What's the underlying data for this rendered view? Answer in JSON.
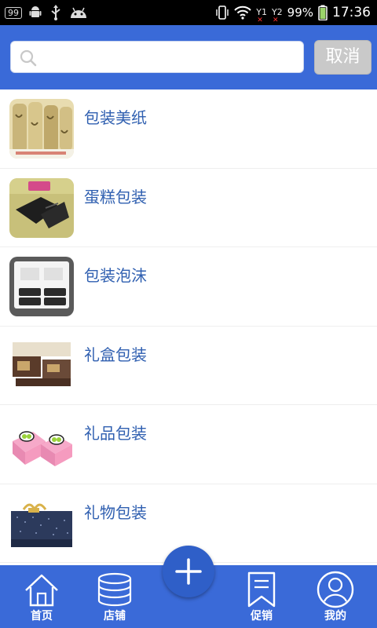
{
  "status_bar": {
    "badge": "99",
    "battery": "99%",
    "time": "17:36",
    "sim1": "Y1",
    "sim2": "Y2",
    "icons": [
      "android-icon",
      "usb-icon",
      "android-debug-icon",
      "vibrate-icon",
      "wifi-icon",
      "signal-icon",
      "battery-icon"
    ]
  },
  "search": {
    "placeholder": "",
    "value": "",
    "cancel_label": "取消"
  },
  "categories": [
    {
      "label": "包装美纸",
      "thumb": "wrapping-paper"
    },
    {
      "label": "蛋糕包装",
      "thumb": "cake-box"
    },
    {
      "label": "包装泡沫",
      "thumb": "foam-packaging"
    },
    {
      "label": "礼盒包装",
      "thumb": "gift-box"
    },
    {
      "label": "礼品包装",
      "thumb": "gift-wrap"
    },
    {
      "label": "礼物包装",
      "thumb": "present-box"
    }
  ],
  "bottom_nav": {
    "items": [
      {
        "label": "首页",
        "icon": "home-icon"
      },
      {
        "label": "店铺",
        "icon": "store-icon"
      },
      {
        "label": "促销",
        "icon": "bookmark-icon"
      },
      {
        "label": "我的",
        "icon": "profile-icon"
      }
    ],
    "fab_icon": "plus-icon"
  },
  "colors": {
    "accent": "#3a6ad8",
    "label": "#2f5fb0",
    "cancel_bg": "#c9c9c9"
  }
}
